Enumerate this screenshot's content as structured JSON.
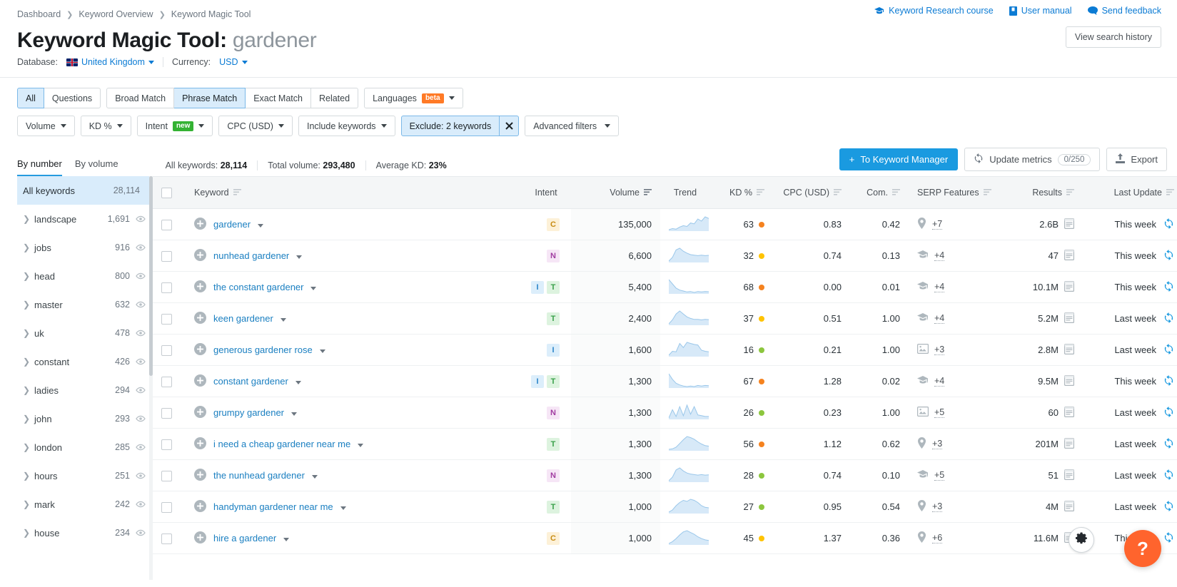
{
  "breadcrumb": [
    "Dashboard",
    "Keyword Overview",
    "Keyword Magic Tool"
  ],
  "help_links": [
    {
      "label": "Keyword Research course",
      "icon": "course-icon"
    },
    {
      "label": "User manual",
      "icon": "book-icon"
    },
    {
      "label": "Send feedback",
      "icon": "chat-icon"
    }
  ],
  "title": {
    "prefix": "Keyword Magic Tool:",
    "term": "gardener"
  },
  "history_button": "View search history",
  "database": {
    "label": "Database:",
    "value": "United Kingdom"
  },
  "currency": {
    "label": "Currency:",
    "value": "USD"
  },
  "match_tabs": [
    {
      "label": "All",
      "active": true
    },
    {
      "label": "Questions",
      "active": false
    }
  ],
  "match_tabs2": [
    {
      "label": "Broad Match",
      "active": false
    },
    {
      "label": "Phrase Match",
      "active": true
    },
    {
      "label": "Exact Match",
      "active": false
    },
    {
      "label": "Related",
      "active": false
    }
  ],
  "languages": {
    "label": "Languages",
    "badge": "beta"
  },
  "filters": [
    {
      "label": "Volume",
      "type": "dropdown"
    },
    {
      "label": "KD %",
      "type": "dropdown"
    },
    {
      "label": "Intent",
      "badge": "new",
      "type": "dropdown"
    },
    {
      "label": "CPC (USD)",
      "type": "dropdown"
    },
    {
      "label": "Include keywords",
      "type": "dropdown"
    },
    {
      "label": "Exclude: 2 keywords",
      "type": "active-clearable"
    },
    {
      "label": "Advanced filters",
      "type": "dropdown"
    }
  ],
  "group_tabs": [
    {
      "label": "By number",
      "active": true
    },
    {
      "label": "By volume",
      "active": false
    }
  ],
  "stats": [
    {
      "label": "All keywords:",
      "value": "28,114"
    },
    {
      "label": "Total volume:",
      "value": "293,480"
    },
    {
      "label": "Average KD:",
      "value": "23%"
    }
  ],
  "toolbar": {
    "to_keyword_manager": "To Keyword Manager",
    "update_metrics": "Update metrics",
    "update_metrics_count": "0/250",
    "export": "Export"
  },
  "sidebar": {
    "header": {
      "label": "All keywords",
      "count": "28,114"
    },
    "items": [
      {
        "label": "landscape",
        "count": "1,691"
      },
      {
        "label": "jobs",
        "count": "916"
      },
      {
        "label": "head",
        "count": "800"
      },
      {
        "label": "master",
        "count": "632"
      },
      {
        "label": "uk",
        "count": "478"
      },
      {
        "label": "constant",
        "count": "426"
      },
      {
        "label": "ladies",
        "count": "294"
      },
      {
        "label": "john",
        "count": "293"
      },
      {
        "label": "london",
        "count": "285"
      },
      {
        "label": "hours",
        "count": "251"
      },
      {
        "label": "mark",
        "count": "242"
      },
      {
        "label": "house",
        "count": "234"
      }
    ]
  },
  "table": {
    "columns": [
      {
        "key": "keyword",
        "label": "Keyword",
        "sortable": true
      },
      {
        "key": "intent",
        "label": "Intent",
        "sortable": false
      },
      {
        "key": "volume",
        "label": "Volume",
        "sortable": true,
        "sorted": true
      },
      {
        "key": "trend",
        "label": "Trend",
        "sortable": false
      },
      {
        "key": "kd",
        "label": "KD %",
        "sortable": true
      },
      {
        "key": "cpc",
        "label": "CPC (USD)",
        "sortable": true
      },
      {
        "key": "com",
        "label": "Com.",
        "sortable": true
      },
      {
        "key": "serp",
        "label": "SERP Features",
        "sortable": true
      },
      {
        "key": "results",
        "label": "Results",
        "sortable": true
      },
      {
        "key": "last_update",
        "label": "Last Update",
        "sortable": true
      }
    ],
    "rows": [
      {
        "keyword": "gardener",
        "intent": [
          "C"
        ],
        "volume": "135,000",
        "trend": [
          30,
          34,
          32,
          40,
          45,
          42,
          55,
          52,
          70,
          62,
          78,
          72
        ],
        "kd": "63",
        "kd_color": "#f5821f",
        "cpc": "0.83",
        "com": "0.42",
        "serp_icon": "map-pin-icon",
        "serp_more": "+7",
        "results": "2.6B",
        "last_update": "This week"
      },
      {
        "keyword": "nunhead gardener",
        "intent": [
          "N"
        ],
        "volume": "6,600",
        "trend": [
          20,
          35,
          65,
          72,
          60,
          52,
          46,
          44,
          42,
          44,
          42,
          43
        ],
        "kd": "32",
        "kd_color": "#ffc300",
        "cpc": "0.74",
        "com": "0.13",
        "serp_icon": "knowledge-icon",
        "serp_more": "+4",
        "results": "47",
        "last_update": "This week"
      },
      {
        "keyword": "the constant gardener",
        "intent": [
          "I",
          "T"
        ],
        "volume": "5,400",
        "trend": [
          80,
          62,
          44,
          36,
          32,
          28,
          30,
          26,
          30,
          28,
          30,
          29
        ],
        "kd": "68",
        "kd_color": "#f5821f",
        "cpc": "0.00",
        "com": "0.01",
        "serp_icon": "knowledge-icon",
        "serp_more": "+4",
        "results": "10.1M",
        "last_update": "This week"
      },
      {
        "keyword": "keen gardener",
        "intent": [
          "T"
        ],
        "volume": "2,400",
        "trend": [
          22,
          38,
          62,
          74,
          62,
          50,
          44,
          40,
          40,
          38,
          40,
          39
        ],
        "kd": "37",
        "kd_color": "#ffc300",
        "cpc": "0.51",
        "com": "1.00",
        "serp_icon": "knowledge-icon",
        "serp_more": "+4",
        "results": "5.2M",
        "last_update": "Last week"
      },
      {
        "keyword": "generous gardener rose",
        "intent": [
          "I"
        ],
        "volume": "1,600",
        "trend": [
          25,
          40,
          38,
          70,
          54,
          74,
          70,
          66,
          64,
          44,
          40,
          38
        ],
        "kd": "16",
        "kd_color": "#8cc63e",
        "cpc": "0.21",
        "com": "1.00",
        "serp_icon": "image-icon",
        "serp_more": "+3",
        "results": "2.8M",
        "last_update": "Last week"
      },
      {
        "keyword": "constant gardener",
        "intent": [
          "I",
          "T"
        ],
        "volume": "1,300",
        "trend": [
          70,
          50,
          36,
          30,
          26,
          24,
          26,
          24,
          28,
          26,
          28,
          27
        ],
        "kd": "67",
        "kd_color": "#f5821f",
        "cpc": "1.28",
        "com": "0.02",
        "serp_icon": "knowledge-icon",
        "serp_more": "+4",
        "results": "9.5M",
        "last_update": "This week"
      },
      {
        "keyword": "grumpy gardener",
        "intent": [
          "N"
        ],
        "volume": "1,300",
        "trend": [
          36,
          58,
          40,
          66,
          42,
          70,
          46,
          66,
          44,
          42,
          40,
          40
        ],
        "kd": "26",
        "kd_color": "#8cc63e",
        "cpc": "0.23",
        "com": "1.00",
        "serp_icon": "image-icon",
        "serp_more": "+5",
        "results": "60",
        "last_update": "Last week"
      },
      {
        "keyword": "i need a cheap gardener near me",
        "intent": [
          "T"
        ],
        "volume": "1,300",
        "trend": [
          22,
          24,
          30,
          44,
          58,
          70,
          66,
          60,
          50,
          42,
          36,
          34
        ],
        "kd": "56",
        "kd_color": "#f5821f",
        "cpc": "1.12",
        "com": "0.62",
        "serp_icon": "map-pin-icon",
        "serp_more": "+3",
        "results": "201M",
        "last_update": "Last week"
      },
      {
        "keyword": "the nunhead gardener",
        "intent": [
          "N"
        ],
        "volume": "1,300",
        "trend": [
          20,
          34,
          62,
          70,
          58,
          50,
          46,
          44,
          42,
          44,
          42,
          43
        ],
        "kd": "28",
        "kd_color": "#8cc63e",
        "cpc": "0.74",
        "com": "0.10",
        "serp_icon": "knowledge-icon",
        "serp_more": "+5",
        "results": "51",
        "last_update": "Last week"
      },
      {
        "keyword": "handyman gardener near me",
        "intent": [
          "T"
        ],
        "volume": "1,000",
        "trend": [
          22,
          30,
          46,
          58,
          66,
          62,
          70,
          66,
          58,
          46,
          40,
          38
        ],
        "kd": "27",
        "kd_color": "#8cc63e",
        "cpc": "0.95",
        "com": "0.54",
        "serp_icon": "map-pin-icon",
        "serp_more": "+3",
        "results": "4M",
        "last_update": "Last week"
      },
      {
        "keyword": "hire a gardener",
        "intent": [
          "C"
        ],
        "volume": "1,000",
        "trend": [
          28,
          34,
          44,
          56,
          66,
          70,
          64,
          58,
          50,
          44,
          40,
          38
        ],
        "kd": "45",
        "kd_color": "#ffc300",
        "cpc": "1.37",
        "com": "0.36",
        "serp_icon": "map-pin-icon",
        "serp_more": "+6",
        "results": "11.6M",
        "last_update": "This week"
      }
    ]
  },
  "fab": {
    "gear": "gear-icon",
    "help": "?"
  },
  "colors": {
    "accent": "#1a9ae0",
    "link": "#1a7fc1",
    "active_chip_bg": "#d9ecfb",
    "kd_easy": "#8cc63e",
    "kd_medium": "#ffc300",
    "kd_hard": "#f5821f",
    "fab_orange": "#ff642d"
  }
}
